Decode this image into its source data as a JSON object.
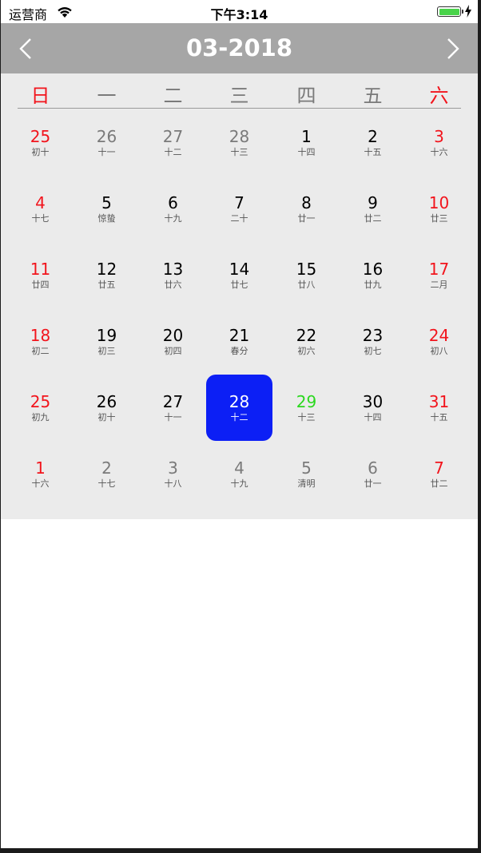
{
  "status_bar": {
    "carrier": "运营商",
    "time": "下午3:14",
    "battery_level_percent": 100,
    "battery_color": "#49d34a"
  },
  "nav": {
    "title": "03-2018",
    "prev_icon": "chevron-left-icon",
    "next_icon": "chevron-right-icon"
  },
  "colors": {
    "weekend": "#f2141c",
    "weekday": "#000000",
    "other_month": "#7a7a7a",
    "today": "#2bd81f",
    "selected_bg": "#0c1ff5"
  },
  "weekdays": [
    {
      "label": "日",
      "weekend": true
    },
    {
      "label": "一",
      "weekend": false
    },
    {
      "label": "二",
      "weekend": false
    },
    {
      "label": "三",
      "weekend": false
    },
    {
      "label": "四",
      "weekend": false
    },
    {
      "label": "五",
      "weekend": false
    },
    {
      "label": "六",
      "weekend": true
    }
  ],
  "selected_day": "28",
  "today_day": "29",
  "weeks": [
    [
      {
        "day": "25",
        "lunar": "初十",
        "state": "other-weekend"
      },
      {
        "day": "26",
        "lunar": "十一",
        "state": "other"
      },
      {
        "day": "27",
        "lunar": "十二",
        "state": "other"
      },
      {
        "day": "28",
        "lunar": "十三",
        "state": "other"
      },
      {
        "day": "1",
        "lunar": "十四",
        "state": "normal"
      },
      {
        "day": "2",
        "lunar": "十五",
        "state": "normal"
      },
      {
        "day": "3",
        "lunar": "十六",
        "state": "weekend"
      }
    ],
    [
      {
        "day": "4",
        "lunar": "十七",
        "state": "weekend"
      },
      {
        "day": "5",
        "lunar": "惊蛰",
        "state": "normal"
      },
      {
        "day": "6",
        "lunar": "十九",
        "state": "normal"
      },
      {
        "day": "7",
        "lunar": "二十",
        "state": "normal"
      },
      {
        "day": "8",
        "lunar": "廿一",
        "state": "normal"
      },
      {
        "day": "9",
        "lunar": "廿二",
        "state": "normal"
      },
      {
        "day": "10",
        "lunar": "廿三",
        "state": "weekend"
      }
    ],
    [
      {
        "day": "11",
        "lunar": "廿四",
        "state": "weekend"
      },
      {
        "day": "12",
        "lunar": "廿五",
        "state": "normal"
      },
      {
        "day": "13",
        "lunar": "廿六",
        "state": "normal"
      },
      {
        "day": "14",
        "lunar": "廿七",
        "state": "normal"
      },
      {
        "day": "15",
        "lunar": "廿八",
        "state": "normal"
      },
      {
        "day": "16",
        "lunar": "廿九",
        "state": "normal"
      },
      {
        "day": "17",
        "lunar": "二月",
        "state": "weekend"
      }
    ],
    [
      {
        "day": "18",
        "lunar": "初二",
        "state": "weekend"
      },
      {
        "day": "19",
        "lunar": "初三",
        "state": "normal"
      },
      {
        "day": "20",
        "lunar": "初四",
        "state": "normal"
      },
      {
        "day": "21",
        "lunar": "春分",
        "state": "normal"
      },
      {
        "day": "22",
        "lunar": "初六",
        "state": "normal"
      },
      {
        "day": "23",
        "lunar": "初七",
        "state": "normal"
      },
      {
        "day": "24",
        "lunar": "初八",
        "state": "weekend"
      }
    ],
    [
      {
        "day": "25",
        "lunar": "初九",
        "state": "weekend"
      },
      {
        "day": "26",
        "lunar": "初十",
        "state": "normal"
      },
      {
        "day": "27",
        "lunar": "十一",
        "state": "normal"
      },
      {
        "day": "28",
        "lunar": "十二",
        "state": "selected"
      },
      {
        "day": "29",
        "lunar": "十三",
        "state": "today"
      },
      {
        "day": "30",
        "lunar": "十四",
        "state": "normal"
      },
      {
        "day": "31",
        "lunar": "十五",
        "state": "weekend"
      }
    ],
    [
      {
        "day": "1",
        "lunar": "十六",
        "state": "other-weekend"
      },
      {
        "day": "2",
        "lunar": "十七",
        "state": "other"
      },
      {
        "day": "3",
        "lunar": "十八",
        "state": "other"
      },
      {
        "day": "4",
        "lunar": "十九",
        "state": "other"
      },
      {
        "day": "5",
        "lunar": "清明",
        "state": "other"
      },
      {
        "day": "6",
        "lunar": "廿一",
        "state": "other"
      },
      {
        "day": "7",
        "lunar": "廿二",
        "state": "other-weekend"
      }
    ]
  ]
}
